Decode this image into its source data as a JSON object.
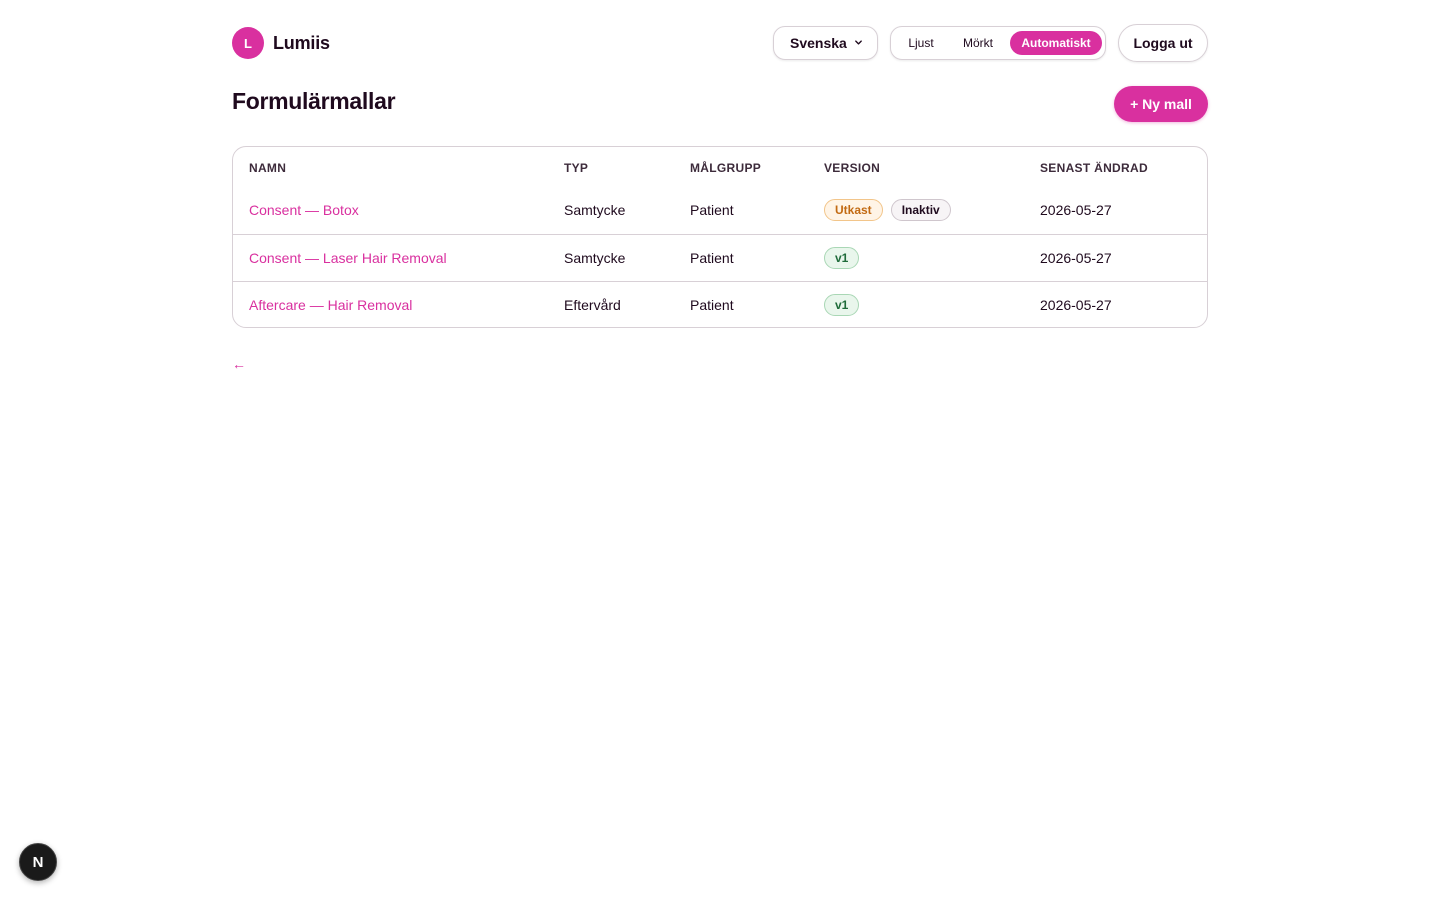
{
  "header": {
    "brand_initial": "L",
    "brand_name": "Lumiis",
    "language": "Svenska",
    "theme_options": [
      "Ljust",
      "Mörkt",
      "Automatiskt"
    ],
    "theme_selected": "Automatiskt",
    "logout_label": "Logga ut"
  },
  "main": {
    "title": "Formulärmallar",
    "new_button_label": "+ Ny mall",
    "table": {
      "columns": [
        "NAMN",
        "TYP",
        "MÅLGRUPP",
        "VERSION",
        "SENAST ÄNDRAD"
      ],
      "rows": [
        {
          "name": "Consent — Botox",
          "type": "Samtycke",
          "audience": "Patient",
          "badges": [
            "Utkast",
            "Inaktiv"
          ],
          "updated": "2026-05-27"
        },
        {
          "name": "Consent — Laser Hair Removal",
          "type": "Samtycke",
          "audience": "Patient",
          "badges": [
            "v1"
          ],
          "updated": "2026-05-27"
        },
        {
          "name": "Aftercare — Hair Removal",
          "type": "Eftervård",
          "audience": "Patient",
          "badges": [
            "v1"
          ],
          "updated": "2026-05-27"
        }
      ]
    },
    "back_link": "←"
  },
  "dev_indicator": "N",
  "colors": {
    "accent": "#d9309f",
    "text": "#1f0a1e",
    "border": "#d8d0d6"
  },
  "icons": {
    "language_chevron": "chevron-down-icon",
    "back": "arrow-left-icon"
  }
}
